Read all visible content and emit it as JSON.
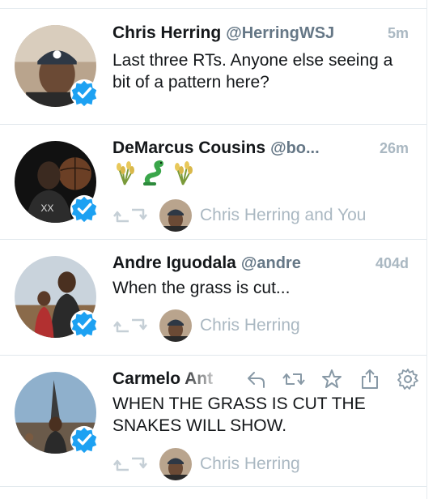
{
  "tweets": [
    {
      "name": "Chris Herring",
      "handle": "@HerringWSJ",
      "time": "5m",
      "text": "Last three RTs. Anyone else seeing a bit of a pattern here?"
    },
    {
      "name": "DeMarcus Cousins",
      "handle": "@bo...",
      "time": "26m",
      "emojis": [
        "🌾",
        "🐍",
        "🌾"
      ],
      "retweeted_by": "Chris Herring and You"
    },
    {
      "name": "Andre Iguodala",
      "handle": "@andre",
      "time": "404d",
      "text": "When the grass is cut...",
      "retweeted_by": "Chris Herring"
    },
    {
      "name": "Carmelo Ant",
      "text": "WHEN THE GRASS IS CUT THE SNAKES WILL SHOW.",
      "retweeted_by": "Chris Herring",
      "hover_actions": [
        "reply-icon",
        "retweet-icon",
        "favorite-icon",
        "share-icon",
        "settings-gear-icon"
      ]
    }
  ],
  "colors": {
    "verified": "#1da1f2",
    "muted": "#aab8c2",
    "handle": "#657786",
    "divider": "#e1e8ed"
  }
}
